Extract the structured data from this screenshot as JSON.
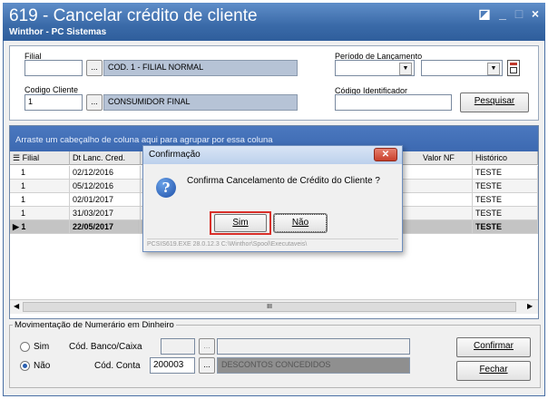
{
  "window": {
    "title": "619 - Cancelar crédito de cliente",
    "subtitle": "Winthor - PC Sistemas",
    "controls": [
      "◪",
      "_",
      "□",
      "×"
    ]
  },
  "filters": {
    "filial_label": "Filial",
    "filial_value": "",
    "filial_dots": "...",
    "filial_desc": "COD. 1 - FILIAL NORMAL",
    "cliente_label": "Codigo Cliente",
    "cliente_value": "1",
    "cliente_dots": "...",
    "cliente_desc": "CONSUMIDOR FINAL",
    "periodo_label": "Período de Lançamento",
    "identificador_label": "Código Identificador",
    "identificador_value": "",
    "pesquisar_label": "Pesquisar"
  },
  "grid": {
    "group_hint": "Arraste um cabeçalho de coluna aqui para agrupar por essa coluna",
    "columns": [
      "Filial",
      "Dt Lanc. Cred.",
      "Valor NF",
      "Histórico"
    ],
    "rows": [
      {
        "filial": "1",
        "data": "02/12/2016",
        "valor": "",
        "historico": "TESTE"
      },
      {
        "filial": "1",
        "data": "05/12/2016",
        "valor": "",
        "historico": "TESTE"
      },
      {
        "filial": "1",
        "data": "02/01/2017",
        "valor": "",
        "historico": "TESTE"
      },
      {
        "filial": "1",
        "data": "31/03/2017",
        "valor": "",
        "historico": "TESTE"
      },
      {
        "filial": "1",
        "data": "22/05/2017",
        "valor": "",
        "historico": "TESTE"
      }
    ],
    "scroll_thumb": "III"
  },
  "bottom": {
    "group_label": "Movimentação de Numerário em Dinheiro",
    "sim_label": "Sim",
    "nao_label": "Não",
    "banco_label": "Cód. Banco/Caixa",
    "banco_value": "",
    "conta_label": "Cód. Conta",
    "conta_value": "200003",
    "conta_dots": "...",
    "conta_desc": "DESCONTOS CONCEDIDOS",
    "confirmar_label": "Confirmar",
    "fechar_label": "Fechar"
  },
  "dialog": {
    "title": "Confirmação",
    "message": "Confirma Cancelamento de Crédito do Cliente ?",
    "sim_label": "Sim",
    "nao_label": "Não",
    "status": "PCSIS619.EXE 28.0.12.3 C:\\Winthor\\Spool\\Executaveis\\"
  },
  "colors": {
    "titlebar": "#3a6aa8",
    "groupbar": "#3c69b1",
    "readonly_field": "#b6c3d6",
    "highlight_border": "#d9302a"
  }
}
